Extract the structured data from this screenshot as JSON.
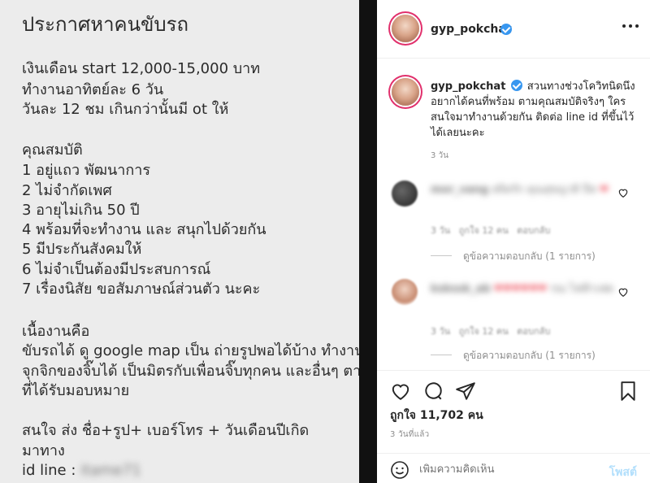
{
  "image_post": {
    "title": "ประกาศหาคนขับรถ",
    "lines": [
      "เงินเดือน start 12,000-15,000 บาท",
      "ทำงานอาทิตย์ละ 6 วัน",
      "วันละ 12 ชม เกินกว่านั้นมี ot ให้",
      "คุณสมบัติ",
      "1 อยู่แถว พัฒนาการ",
      "2 ไม่จำกัดเพศ",
      "3 อายุไม่เกิน 50 ปี",
      "4 พร้อมที่จะทำงาน และ สนุกไปด้วยกัน",
      "5 มีประกันสังคมให้",
      "6 ไม่จำเป็นต้องมีประสบการณ์",
      "7 เรื่องนิสัย ขอสัมภาษณ์ส่วนตัว นะคะ",
      "เนื้องานคือ",
      "ขับรถได้ ดู google map เป็น ถ่ายรูปพอได้บ้าง ทำงาน",
      "จุกจิกของจิ๊บได้ เป็นมิตรกับเพื่อนจิ๊บทุกคน และอื่นๆ ตาม",
      "ที่ได้รับมอบหมาย",
      "สนใจ ส่ง ชื่อ+รูป+ เบอร์โทร + วันเดือนปีเกิด",
      "มาทาง",
      "id line :"
    ],
    "blurred_id": "itame71"
  },
  "header": {
    "username": "gyp_pokchat"
  },
  "caption": {
    "username": "gyp_pokchat",
    "text": "สวนทางช่วงโควิทนิดนึง อยากได้คนที่พร้อม ตามคุณสมบัติจริงๆ ใครสนใจมาทำงานด้วยกัน ติดต่อ line id ที่ขึ้นไว้ได้เลยนะคะ",
    "age": "3 วัน"
  },
  "comments": [
    {
      "username": "mor_vang",
      "text": "สถิตรัก คุณสุขญาติ ปีท",
      "meta_age": "3 วัน",
      "meta_likes": "ถูกใจ 12 คน",
      "meta_reply": "ตอบกลับ",
      "view_replies": "ดูข้อความตอบกลับ (1 รายการ)"
    },
    {
      "username": "kskssk_ab",
      "text": "รณ ไฟฟ้าเฟด",
      "meta_age": "3 วัน",
      "meta_likes": "ถูกใจ 12 คน",
      "meta_reply": "ตอบกลับ",
      "view_replies": "ดูข้อความตอบกลับ (1 รายการ)"
    }
  ],
  "likes_label": "ถูกใจ 11,702 คน",
  "time_label": "3 วันที่แล้ว",
  "comment_input": {
    "placeholder": "เพิ่มความคิดเห็น",
    "post_label": "โพสต์"
  },
  "colors": {
    "verified": "#3897f0",
    "story_ring": "#e1306c",
    "post_button": "#b2dffc",
    "heart_red": "#ed4956"
  }
}
